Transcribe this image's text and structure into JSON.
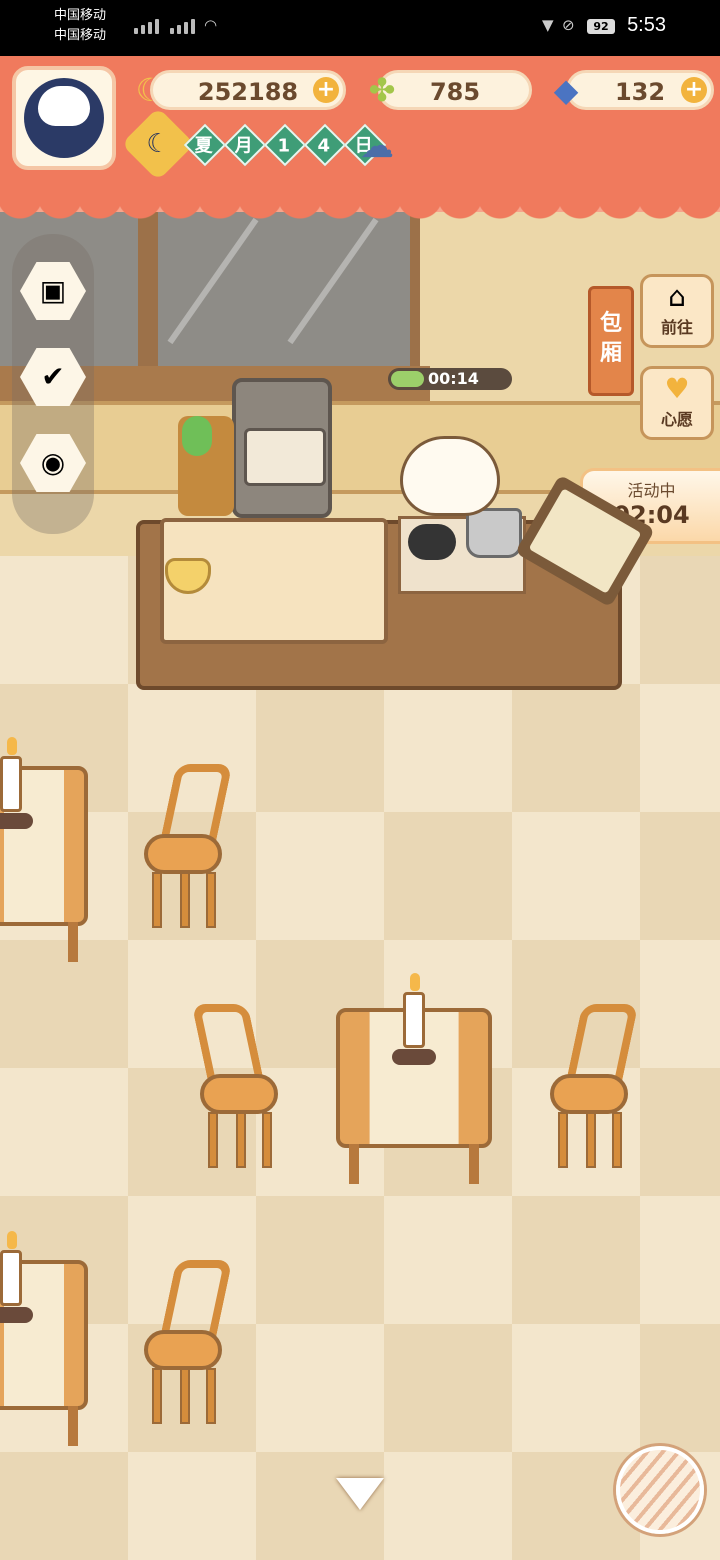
{
  "status_bar": {
    "carrier_1": "中国移动",
    "carrier_2": "中国移动",
    "battery": "92",
    "time": "5:53"
  },
  "hud": {
    "bananas": "252188",
    "clovers": "785",
    "fish": "132",
    "date_chars": [
      "夏",
      "月",
      "1",
      "4",
      "日"
    ],
    "weather_icon": "rain-cloud-icon"
  },
  "kitchen": {
    "cook_timer": "00:14",
    "cook_progress": 0.28
  },
  "side": {
    "private_room": "包厢",
    "goto_label": "前往",
    "wish_label": "心愿",
    "event_label": "活动中",
    "event_timer": "02:04"
  },
  "left_menu": [
    "tv-icon",
    "notice-board-icon",
    "camera-icon"
  ],
  "colors": {
    "hud_bg": "#f07a5d",
    "date_chip": "#3f9d77",
    "accent": "#f2b33d"
  }
}
